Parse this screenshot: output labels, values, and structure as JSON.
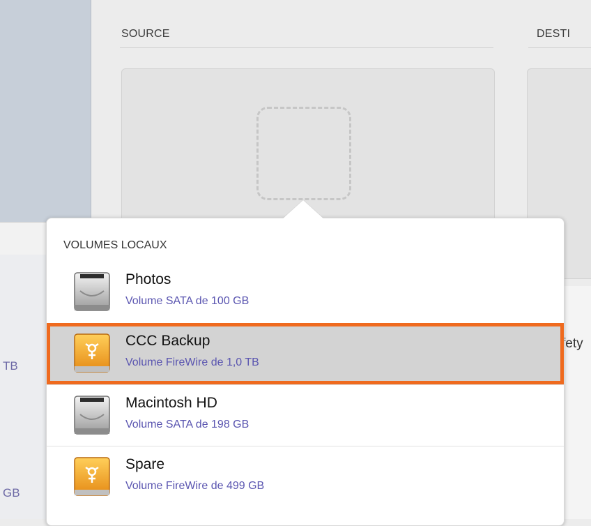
{
  "sidebar": {
    "partial_texts": [
      "TB",
      "GB"
    ]
  },
  "main": {
    "source_label": "SOURCE",
    "destination_label": "DESTI"
  },
  "partial_text_right": "fety",
  "popover": {
    "group_header": "VOLUMES LOCAUX",
    "volumes": [
      {
        "name": "Photos",
        "description": "Volume SATA de 100 GB",
        "icon": "internal-hard-drive-icon",
        "selected": false
      },
      {
        "name": "CCC Backup",
        "description": "Volume FireWire de 1,0 TB",
        "icon": "firewire-drive-icon",
        "selected": true
      },
      {
        "name": "Macintosh HD",
        "description": "Volume SATA de 198 GB",
        "icon": "internal-hard-drive-icon",
        "selected": false
      },
      {
        "name": "Spare",
        "description": "Volume FireWire de 499 GB",
        "icon": "firewire-drive-icon",
        "selected": false
      }
    ]
  },
  "colors": {
    "selection_outline": "#ef6a1e",
    "description_text": "#5a55b0",
    "sidebar": "#c7cfd9"
  }
}
